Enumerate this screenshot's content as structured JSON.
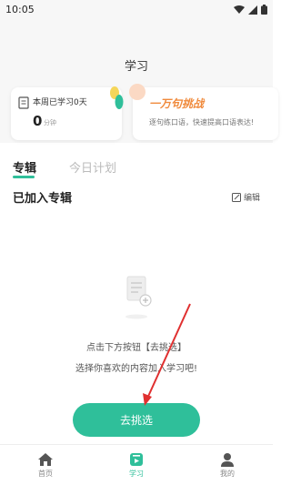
{
  "status_bar": {
    "time": "10:05"
  },
  "header": {
    "title": "学习"
  },
  "study_card": {
    "label": "本周已学习0天",
    "minutes": "0",
    "unit": "分钟"
  },
  "challenge_card": {
    "title": "一万句挑战",
    "subtitle": "逐句练口语，快速提高口语表达!"
  },
  "tabs": [
    {
      "label": "专辑"
    },
    {
      "label": "今日计划"
    }
  ],
  "section": {
    "title": "已加入专辑",
    "edit_label": "编辑"
  },
  "empty_state": {
    "line1": "点击下方按钮【去挑选】",
    "line2": "选择你喜欢的内容加入学习吧!"
  },
  "cta": {
    "label": "去挑选"
  },
  "bottom_nav": [
    {
      "label": "首页",
      "icon": "home-icon"
    },
    {
      "label": "学习",
      "icon": "study-icon"
    },
    {
      "label": "我的",
      "icon": "profile-icon"
    }
  ],
  "colors": {
    "accent": "#2fbf9a",
    "challenge": "#f08a3c",
    "annotation_arrow": "#e03030"
  }
}
